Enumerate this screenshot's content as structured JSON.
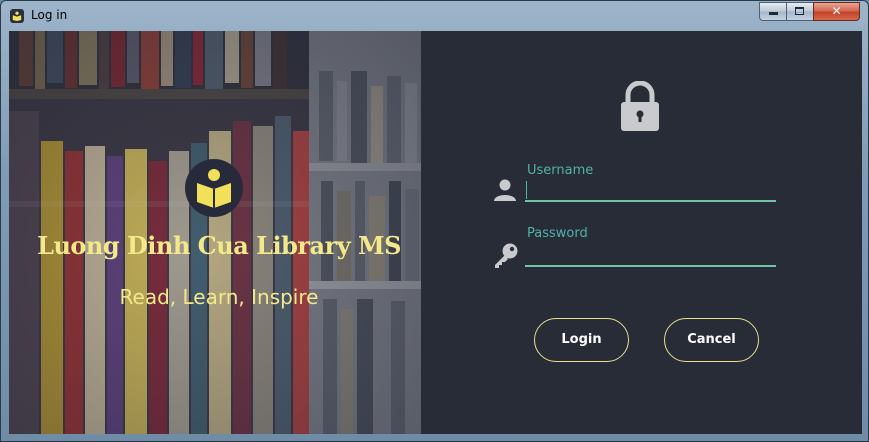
{
  "window": {
    "title": "Log in",
    "icons": {
      "app": "library-app-icon",
      "minimize": "minimize-icon",
      "maximize": "maximize-icon",
      "close": "close-icon"
    }
  },
  "hero": {
    "title": "Luong Dinh Cua Library MS",
    "tagline": "Read, Learn, Inspire",
    "logo_icon": "reader-book-icon"
  },
  "form": {
    "lock_icon": "lock-icon",
    "username": {
      "label": "Username",
      "value": "",
      "icon": "user-icon"
    },
    "password": {
      "label": "Password",
      "value": "",
      "icon": "key-icon"
    },
    "buttons": {
      "login": "Login",
      "cancel": "Cancel"
    }
  },
  "colors": {
    "panel_bg": "#282c37",
    "accent_teal": "#4fb3a7",
    "underline_green": "#6fc3a5",
    "brand_yellow": "#f3e98a",
    "button_border": "#e6e08a"
  }
}
